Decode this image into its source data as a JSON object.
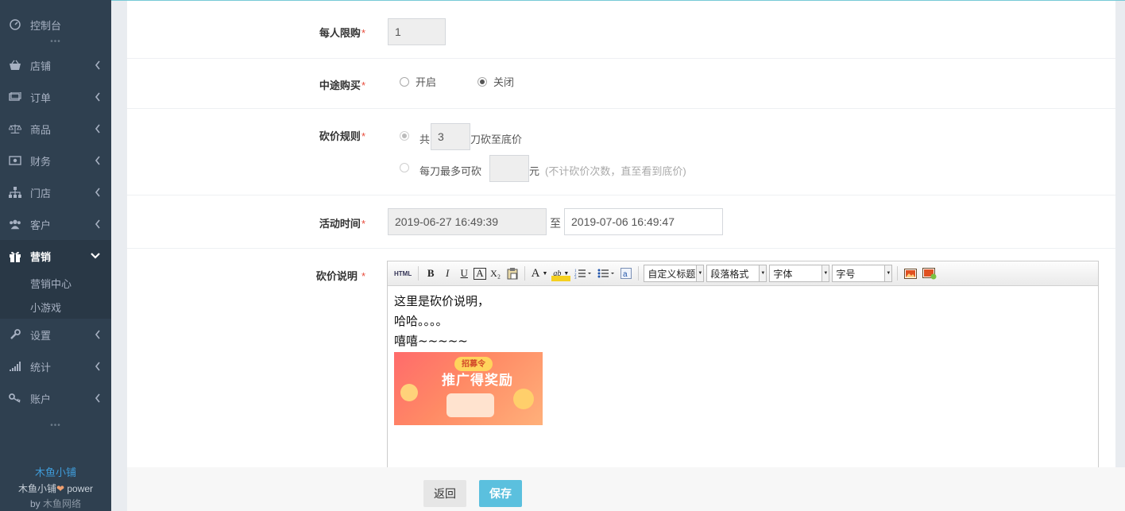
{
  "sidebar": {
    "items": [
      {
        "label": "控制台",
        "icon": "dashboard-icon"
      },
      {
        "label": "店铺",
        "icon": "shop-icon"
      },
      {
        "label": "订单",
        "icon": "order-icon"
      },
      {
        "label": "商品",
        "icon": "scale-icon"
      },
      {
        "label": "财务",
        "icon": "money-icon"
      },
      {
        "label": "门店",
        "icon": "sitemap-icon"
      },
      {
        "label": "客户",
        "icon": "users-icon"
      },
      {
        "label": "营销",
        "icon": "gift-icon"
      },
      {
        "label": "设置",
        "icon": "wrench-icon"
      },
      {
        "label": "统计",
        "icon": "signal-icon"
      },
      {
        "label": "账户",
        "icon": "key-icon"
      }
    ],
    "marketing_sub": [
      "营销中心",
      "小游戏"
    ],
    "dots": "•••",
    "brand_name": "木鱼小铺",
    "brand_power_prefix": "木鱼小铺",
    "brand_power_suffix": " power",
    "brand_by": "by ",
    "brand_company": "木鱼网络"
  },
  "form": {
    "limit": {
      "label": "每人限购",
      "value": "1"
    },
    "midway": {
      "label": "中途购买",
      "option_on": "开启",
      "option_off": "关闭",
      "selected": "关闭"
    },
    "rule": {
      "label": "砍价规则",
      "opt1_prefix": "共",
      "opt1_value": "3",
      "opt1_suffix": "刀砍至底价",
      "opt2_prefix": "每刀最多可砍",
      "opt2_value": "",
      "opt2_suffix": "元",
      "opt2_hint": "(不计砍价次数，直至看到底价)"
    },
    "time": {
      "label": "活动时间",
      "start": "2019-06-27 16:49:39",
      "to": "至",
      "end": "2019-07-06 16:49:47"
    },
    "desc": {
      "label": "砍价说明",
      "toolbar": {
        "html": "HTML",
        "bold": "B",
        "italic": "I",
        "underline": "U",
        "border": "A",
        "subscript": "X₂",
        "font_color": "A",
        "highlight": "ab",
        "heading": "自定义标题",
        "paragraph": "段落格式",
        "font": "字体",
        "size": "字号"
      },
      "lines": [
        "这里是砍价说明，",
        "哈哈。。。。",
        "嘻嘻~~~~~"
      ],
      "image": {
        "badge": "招募令",
        "title": "推广得奖励"
      }
    }
  },
  "footer": {
    "back": "返回",
    "save": "保存"
  },
  "required_mark": "*",
  "colors": {
    "sidebar": "#2f4050",
    "accent": "#5bc0de",
    "required": "#e74c3c"
  }
}
